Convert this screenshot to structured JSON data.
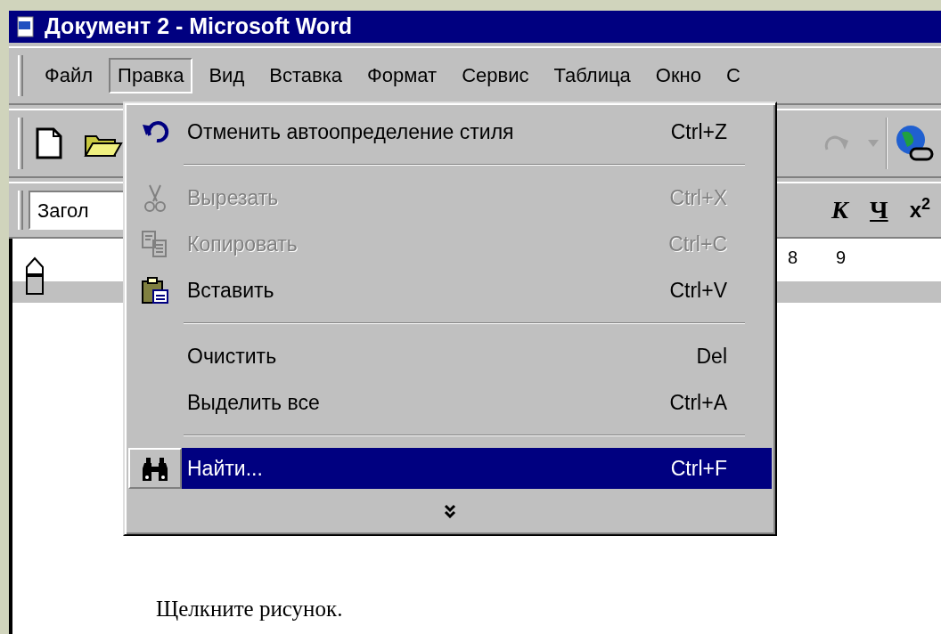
{
  "window": {
    "title": "Документ 2 - Microsoft Word"
  },
  "menu_bar": [
    {
      "label": "Файл",
      "selected": false
    },
    {
      "label": "Правка",
      "selected": true
    },
    {
      "label": "Вид",
      "selected": false
    },
    {
      "label": "Вставка",
      "selected": false
    },
    {
      "label": "Формат",
      "selected": false
    },
    {
      "label": "Сервис",
      "selected": false
    },
    {
      "label": "Таблица",
      "selected": false
    },
    {
      "label": "Окно",
      "selected": false
    },
    {
      "label": "С",
      "selected": false
    }
  ],
  "formatting_toolbar": {
    "style_box": {
      "value": "Загол"
    },
    "buttons": [
      {
        "kind": "italic",
        "label": "К"
      },
      {
        "kind": "underline",
        "label": "Ч"
      },
      {
        "kind": "superscript",
        "label": "x$^{2}$"
      }
    ]
  },
  "ruler": {
    "labels": [
      "8",
      "9"
    ]
  },
  "edit_menu": [
    {
      "kind": "command",
      "label": "Отменить автоопределение стиля",
      "shortcut": "Ctrl+Z",
      "disabled": false,
      "selected": false
    },
    {
      "kind": "separator"
    },
    {
      "kind": "command",
      "label": "Вырезать",
      "shortcut": "Ctrl+X",
      "disabled": true,
      "selected": false
    },
    {
      "kind": "command",
      "label": "Копировать",
      "shortcut": "Ctrl+C",
      "disabled": true,
      "selected": false
    },
    {
      "kind": "command",
      "label": "Вставить",
      "shortcut": "Ctrl+V",
      "disabled": false,
      "selected": false
    },
    {
      "kind": "separator"
    },
    {
      "kind": "command",
      "label": "Очистить",
      "shortcut": "Del",
      "disabled": false,
      "selected": false
    },
    {
      "kind": "command",
      "label": "Выделить все",
      "shortcut": "Ctrl+A",
      "disabled": false,
      "selected": false
    },
    {
      "kind": "separator"
    },
    {
      "kind": "command",
      "label": "Найти...",
      "shortcut": "Ctrl+F",
      "disabled": false,
      "selected": true
    },
    {
      "kind": "expand"
    }
  ],
  "document": {
    "text": "Щелкните рисунок."
  }
}
